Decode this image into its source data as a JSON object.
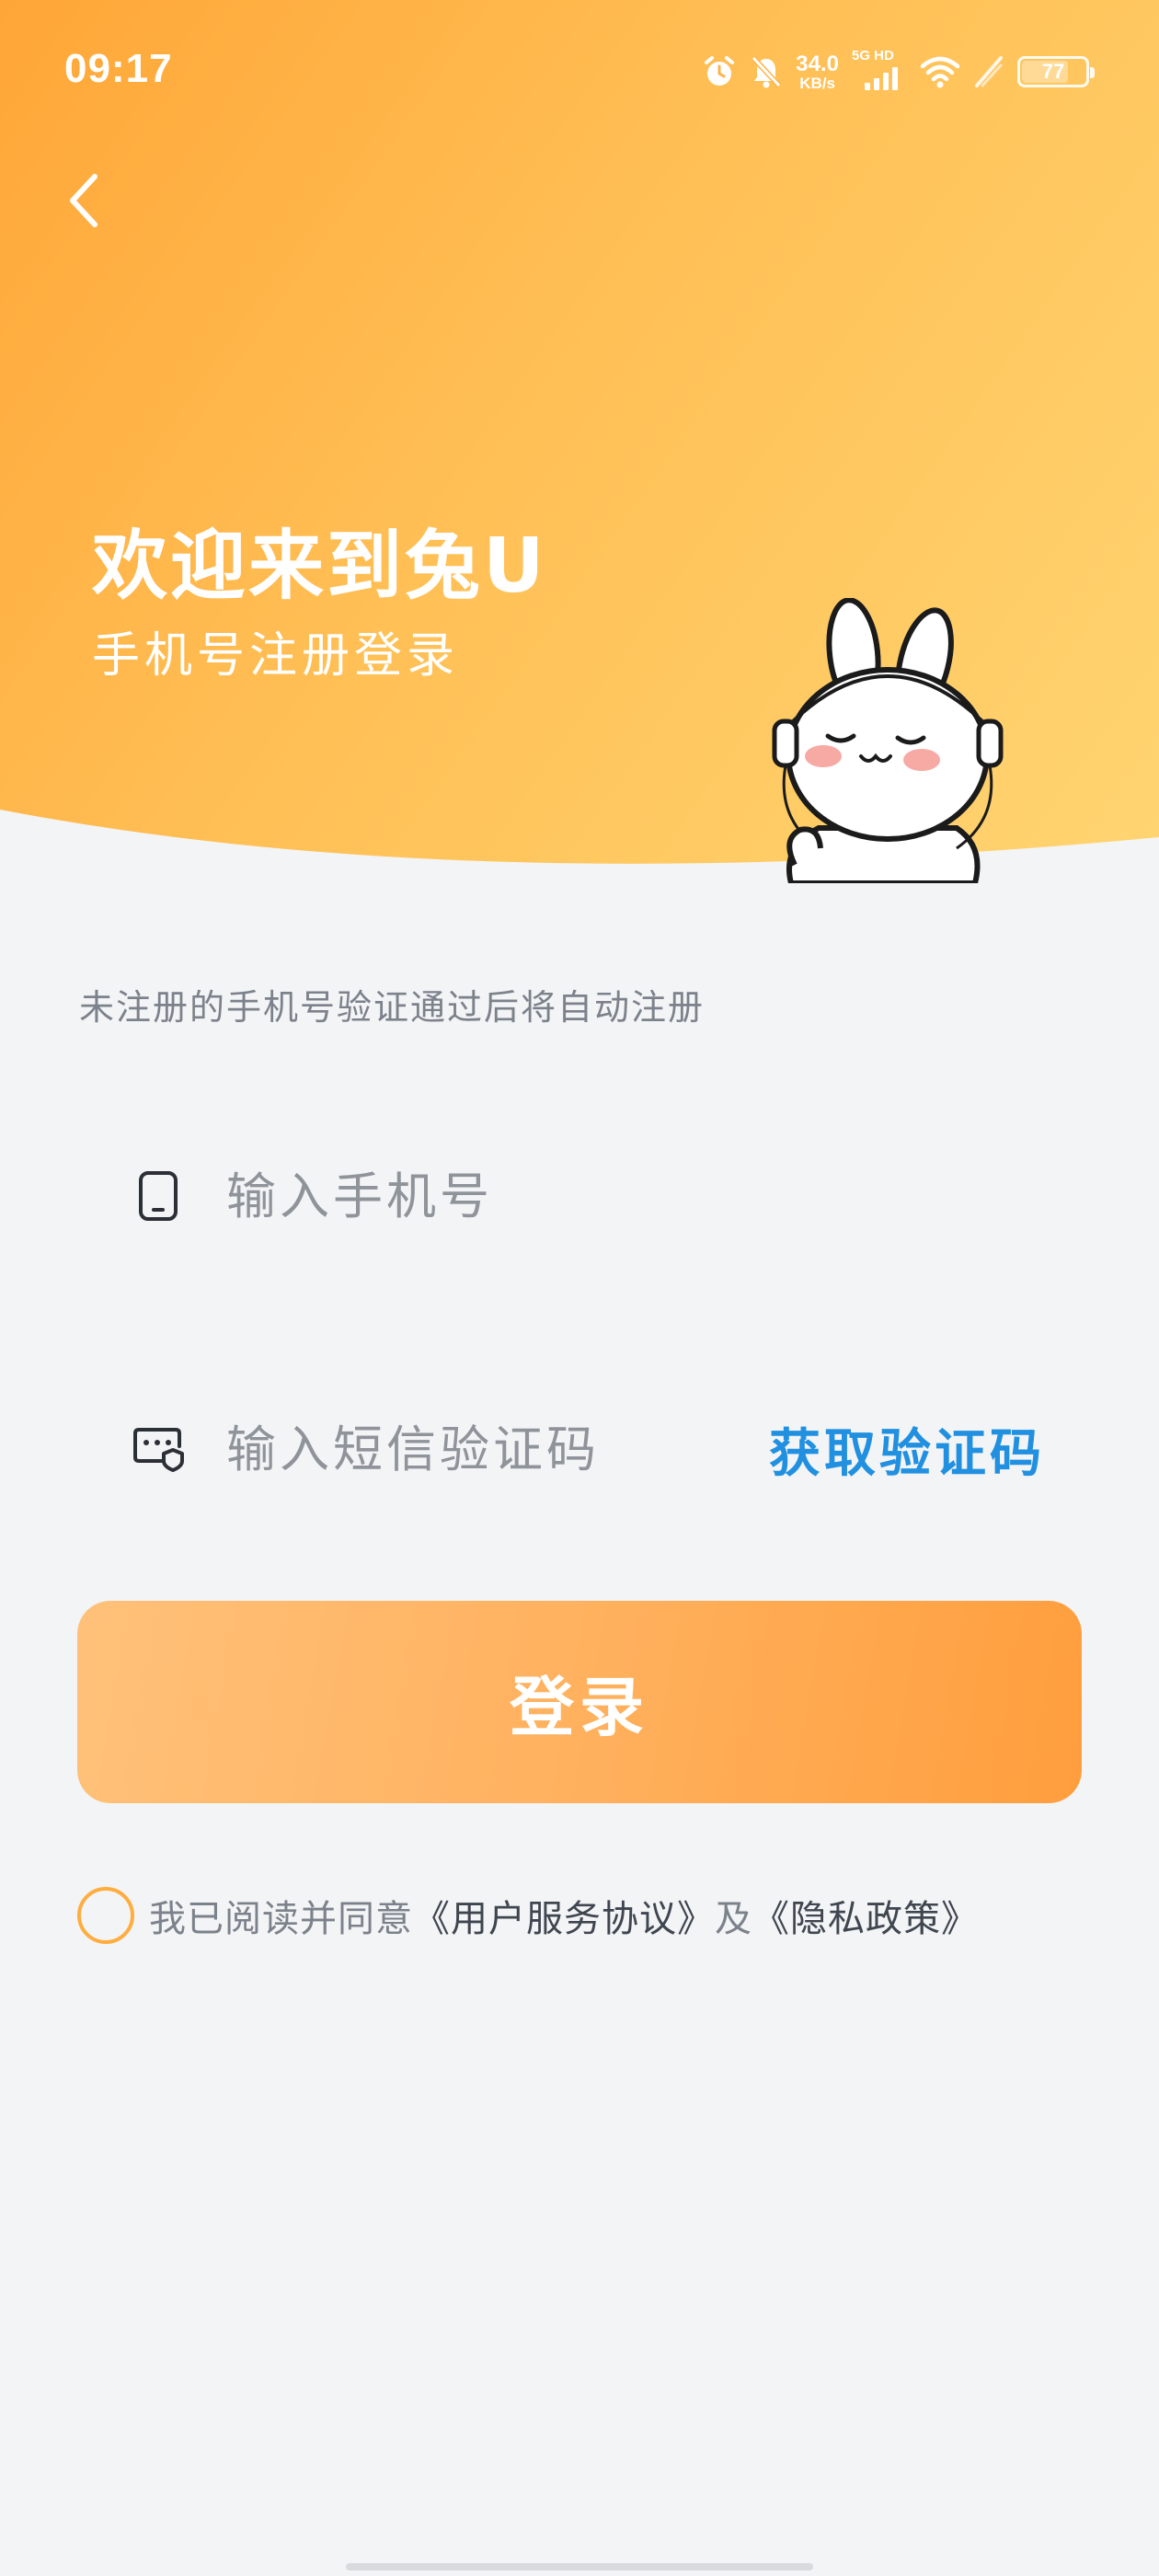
{
  "status_bar": {
    "time": "09:17",
    "net_speed_value": "34.0",
    "net_speed_unit": "KB/s",
    "signal_label": "5G HD",
    "battery": "77",
    "icons": [
      "alarm-icon",
      "mute-bell-icon",
      "signal-icon",
      "wifi-icon",
      "charging-icon",
      "battery-icon"
    ]
  },
  "header": {
    "title": "欢迎来到兔U",
    "subtitle": "手机号注册登录"
  },
  "form": {
    "hint": "未注册的手机号验证通过后将自动注册",
    "phone_placeholder": "输入手机号",
    "code_placeholder": "输入短信验证码",
    "get_code_label": "获取验证码",
    "login_label": "登录"
  },
  "agreement": {
    "prefix": "我已阅读并同意",
    "terms_link": "《用户服务协议》",
    "conjunction": "及",
    "privacy_link": "《隐私政策》"
  },
  "colors": {
    "header_gradient_start": "#ffa637",
    "header_gradient_end": "#ffd572",
    "accent_blue": "#2190e0",
    "button_gradient_start": "#ffc17a",
    "button_gradient_end": "#ff9e3d",
    "background": "#f3f4f6"
  }
}
